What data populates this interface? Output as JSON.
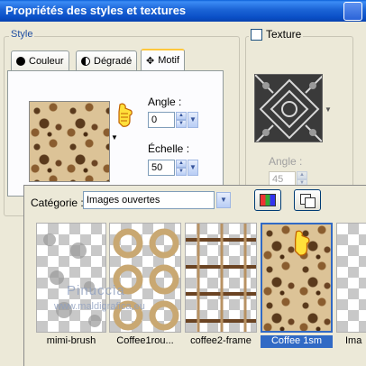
{
  "window": {
    "title": "Propriétés des styles et textures"
  },
  "style_group": {
    "legend": "Style",
    "tabs": [
      {
        "label": "Couleur",
        "icon": "filled-circle-icon"
      },
      {
        "label": "Dégradé",
        "icon": "half-circle-icon"
      },
      {
        "label": "Motif",
        "icon": "pattern-icon",
        "active": true
      }
    ],
    "angle": {
      "label": "Angle :",
      "value": "0"
    },
    "scale": {
      "label": "Échelle :",
      "value": "50"
    }
  },
  "texture_group": {
    "checkbox_label": "Texture",
    "checked": false,
    "angle": {
      "label": "Angle :",
      "value": "45"
    }
  },
  "pattern_popup": {
    "category_label": "Catégorie :",
    "category_value": "Images ouvertes",
    "thumbnails": [
      {
        "label": "mimi-brush",
        "selected": false
      },
      {
        "label": "Coffee1rou...",
        "selected": false
      },
      {
        "label": "coffee2-frame",
        "selected": false
      },
      {
        "label": "Coffee 1sm",
        "selected": true
      },
      {
        "label": "Ima",
        "selected": false
      }
    ],
    "watermark_line1": "Pinuccia",
    "watermark_line2": "www.maldigrafica.eu"
  },
  "colors": {
    "titlebar": "#0a4fc7",
    "selection": "#316ac5",
    "window_bg": "#ece9d8",
    "tab_highlight": "#ffc83c"
  }
}
